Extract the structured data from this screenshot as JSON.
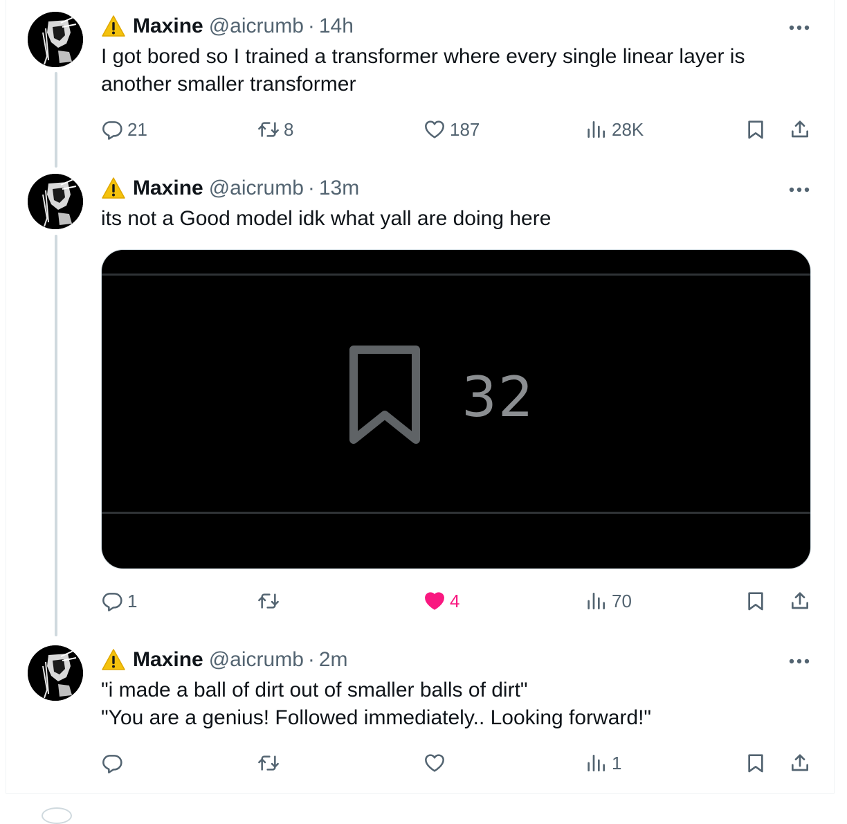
{
  "tweets": [
    {
      "name": "Maxine",
      "handle": "@aicrumb",
      "separator": "·",
      "time": "14h",
      "text_lines": [
        "I got bored so I trained a transformer where every single linear layer is",
        "another smaller transformer"
      ],
      "replies": "21",
      "retweets": "8",
      "likes": "187",
      "views": "28K",
      "liked": false
    },
    {
      "name": "Maxine",
      "handle": "@aicrumb",
      "separator": "·",
      "time": "13m",
      "text_lines": [
        "its not a Good model idk what yall are doing here"
      ],
      "media": {
        "bookmark_count": "32",
        "icon": "bookmark-icon"
      },
      "replies": "1",
      "retweets": "",
      "likes": "4",
      "views": "70",
      "liked": true
    },
    {
      "name": "Maxine",
      "handle": "@aicrumb",
      "separator": "·",
      "time": "2m",
      "text_lines": [
        "\"i made a ball of dirt out of smaller balls of dirt\"",
        "\"You are a genius! Followed immediately.. Looking forward!\""
      ],
      "replies": "",
      "retweets": "",
      "likes": "",
      "views": "1",
      "liked": false
    }
  ],
  "icons": {
    "warning": "warning-icon",
    "reply": "reply-icon",
    "retweet": "retweet-icon",
    "like": "heart-icon",
    "views": "views-icon",
    "bookmark": "bookmark-icon",
    "share": "share-icon",
    "more": "more-icon"
  },
  "colors": {
    "text": "#0f1419",
    "secondary": "#536471",
    "like": "#f91880",
    "thread_line": "#cfd9de",
    "warning": "#f4c20d"
  }
}
